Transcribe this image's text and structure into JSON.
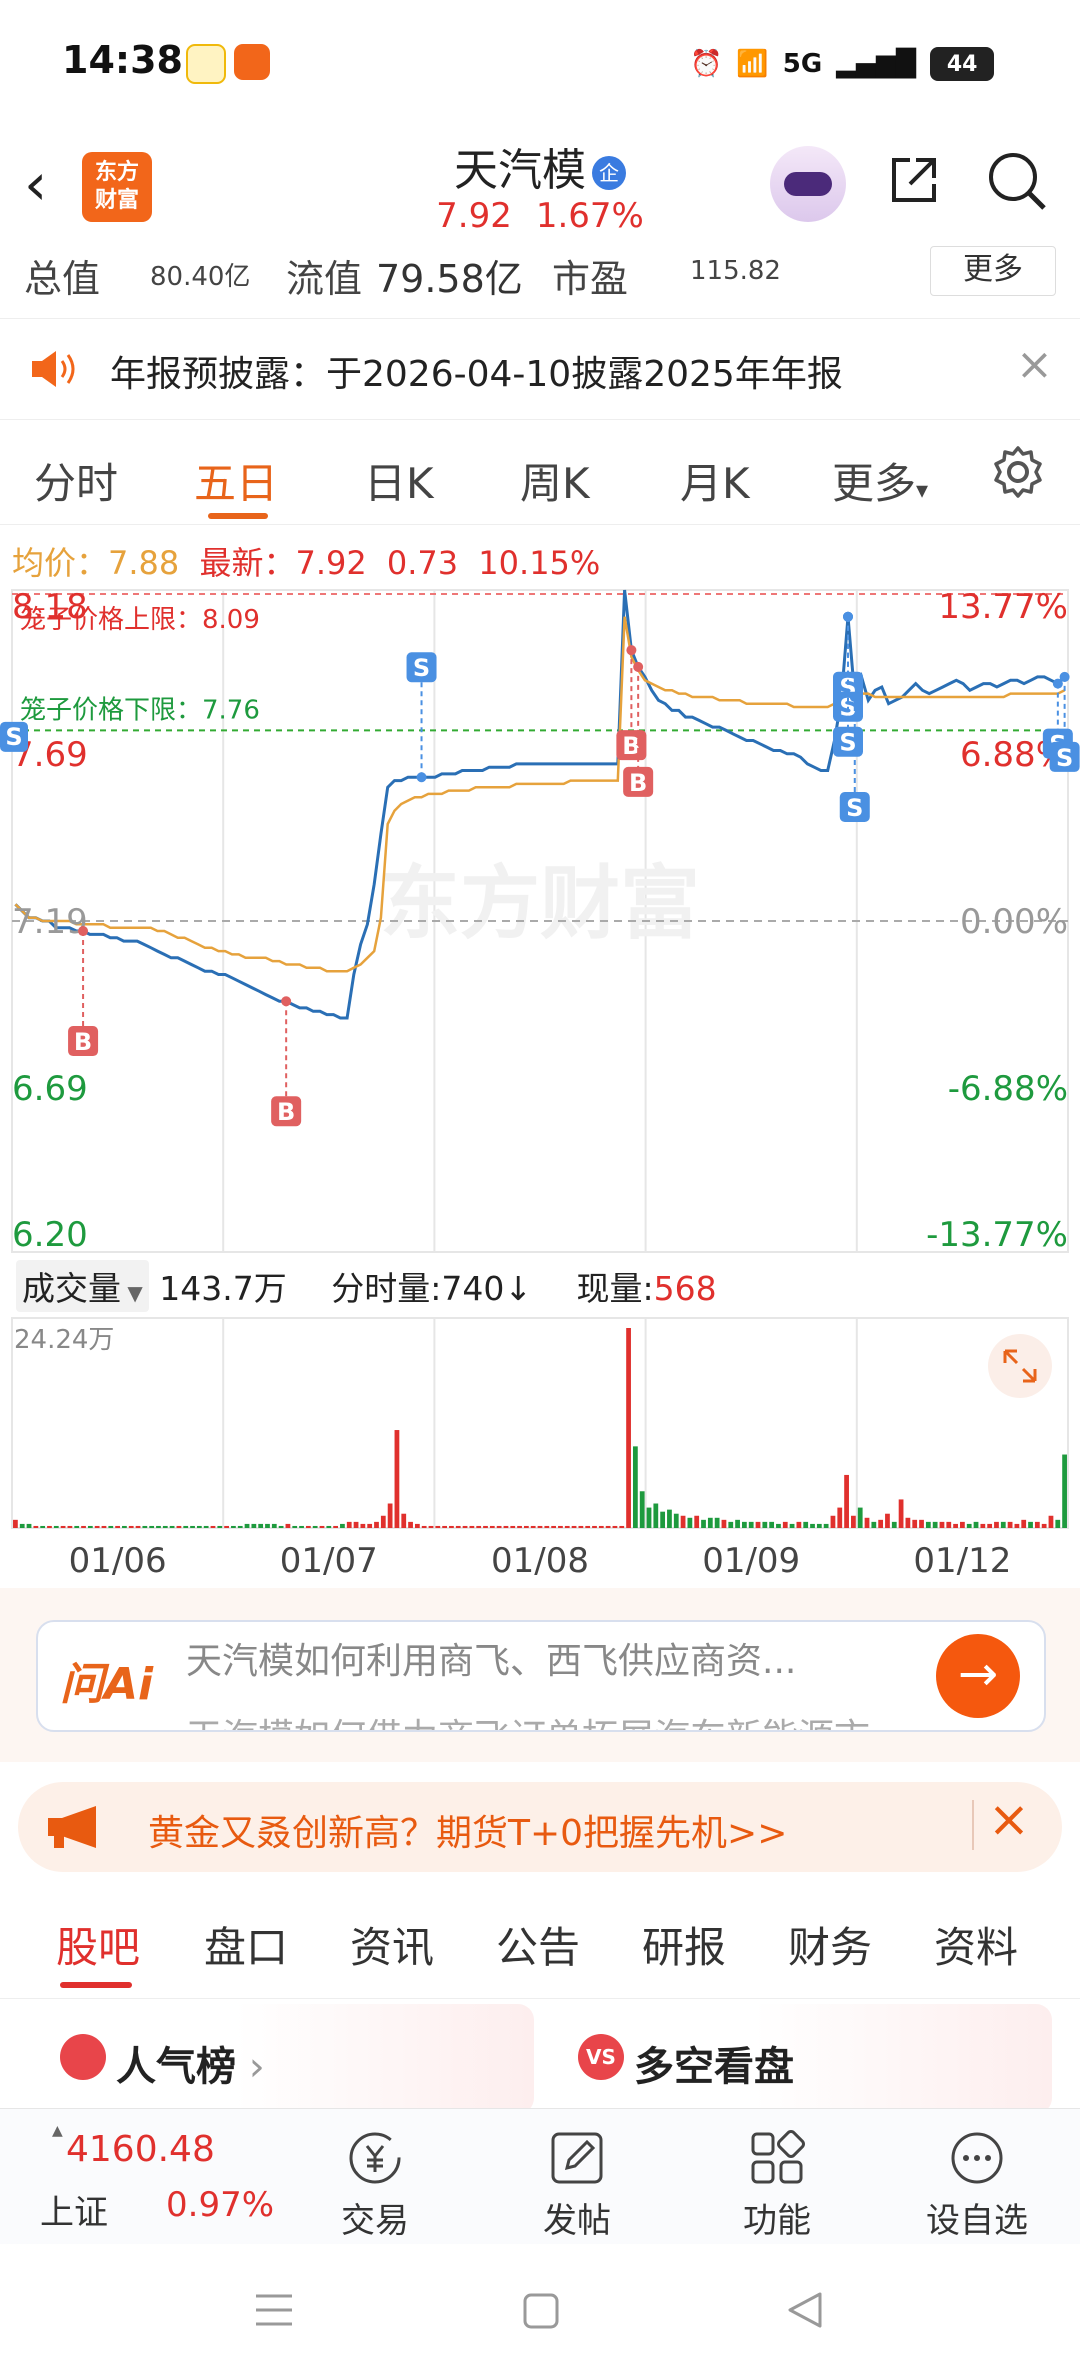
{
  "status_bar": {
    "time": "14:38",
    "network": "5G",
    "battery": "44"
  },
  "header": {
    "logo_line1": "东方",
    "logo_line2": "财富",
    "stock_name": "天汽模",
    "stock_badge": "企",
    "price": "7.92",
    "change_pct": "1.67%"
  },
  "stats": {
    "total_label": "总值",
    "total_value": "80.40亿",
    "float_label": "流值",
    "float_value": "79.58亿",
    "pe_label": "市盈",
    "pe_value": "115.82",
    "more_label": "更多"
  },
  "notice": {
    "text": "年报预披露：于2026-04-10披露2025年年报"
  },
  "chart_tabs": [
    {
      "label": "分时",
      "active": false
    },
    {
      "label": "五日",
      "active": true
    },
    {
      "label": "日K",
      "active": false
    },
    {
      "label": "周K",
      "active": false
    },
    {
      "label": "月K",
      "active": false
    },
    {
      "label": "更多",
      "active": false
    }
  ],
  "price_info": {
    "avg_label": "均价：",
    "avg_value": "7.88",
    "latest_label": "最新：",
    "latest_value": "7.92",
    "change": "0.73",
    "change_pct": "10.15%"
  },
  "chart_data": {
    "type": "line",
    "x_labels": [
      "01/06",
      "01/07",
      "01/08",
      "01/09",
      "01/12"
    ],
    "y_left_ticks": [
      "8.18",
      "7.69",
      "7.19",
      "6.69",
      "6.20"
    ],
    "y_right_ticks": [
      "13.77%",
      "6.88%",
      "0.00%",
      "-6.88%",
      "-13.77%"
    ],
    "ylim": [
      6.2,
      8.18
    ],
    "prev_close": 7.19,
    "cage_upper_label": "笼子价格上限：8.09",
    "cage_upper": 8.09,
    "cage_lower_label": "笼子价格下限：7.76",
    "cage_lower": 7.76,
    "series": [
      {
        "values": [
          7.24,
          7.22,
          7.2,
          7.2,
          7.19,
          7.19,
          7.17,
          7.17,
          7.17,
          7.16,
          7.16,
          7.15,
          7.15,
          7.15,
          7.14,
          7.14,
          7.13,
          7.13,
          7.13,
          7.12,
          7.11,
          7.1,
          7.09,
          7.08,
          7.08,
          7.07,
          7.06,
          7.05,
          7.04,
          7.04,
          7.03,
          7.03,
          7.02,
          7.01,
          7.0,
          6.99,
          6.98,
          6.97,
          6.96,
          6.95,
          6.95,
          6.94,
          6.93,
          6.93,
          6.92,
          6.92,
          6.91,
          6.91,
          6.9,
          6.9,
          7.03,
          7.12,
          7.18,
          7.3,
          7.45,
          7.59,
          7.61,
          7.61,
          7.62,
          7.62,
          7.62,
          7.62,
          7.62,
          7.63,
          7.63,
          7.63,
          7.64,
          7.64,
          7.64,
          7.64,
          7.65,
          7.65,
          7.65,
          7.65,
          7.66,
          7.66,
          7.66,
          7.66,
          7.66,
          7.66,
          7.66,
          7.66,
          7.66,
          7.66,
          7.66,
          7.66,
          7.66,
          7.66,
          7.66,
          7.66,
          8.18,
          8.0,
          7.95,
          7.92,
          7.88,
          7.85,
          7.84,
          7.82,
          7.82,
          7.8,
          7.8,
          7.79,
          7.78,
          7.77,
          7.77,
          7.76,
          7.75,
          7.74,
          7.73,
          7.73,
          7.72,
          7.71,
          7.7,
          7.7,
          7.69,
          7.69,
          7.68,
          7.66,
          7.65,
          7.64,
          7.64,
          7.73,
          7.85,
          8.1,
          7.86,
          7.92,
          7.85,
          7.88,
          7.89,
          7.84,
          7.85,
          7.86,
          7.88,
          7.9,
          7.88,
          7.87,
          7.88,
          7.89,
          7.9,
          7.91,
          7.9,
          7.88,
          7.89,
          7.9,
          7.9,
          7.89,
          7.9,
          7.91,
          7.91,
          7.9,
          7.91,
          7.92,
          7.92,
          7.91,
          7.9,
          7.92
        ]
      },
      {
        "values": [
          7.24,
          7.22,
          7.2,
          7.2,
          7.19,
          7.19,
          7.19,
          7.19,
          7.19,
          7.18,
          7.18,
          7.18,
          7.18,
          7.18,
          7.17,
          7.17,
          7.17,
          7.17,
          7.17,
          7.17,
          7.17,
          7.16,
          7.16,
          7.15,
          7.14,
          7.14,
          7.13,
          7.12,
          7.11,
          7.11,
          7.1,
          7.1,
          7.09,
          7.09,
          7.08,
          7.08,
          7.08,
          7.08,
          7.07,
          7.07,
          7.06,
          7.06,
          7.06,
          7.05,
          7.05,
          7.05,
          7.04,
          7.04,
          7.04,
          7.04,
          7.05,
          7.06,
          7.08,
          7.1,
          7.2,
          7.48,
          7.52,
          7.54,
          7.55,
          7.56,
          7.56,
          7.57,
          7.57,
          7.57,
          7.58,
          7.58,
          7.58,
          7.58,
          7.59,
          7.59,
          7.59,
          7.59,
          7.59,
          7.59,
          7.6,
          7.6,
          7.6,
          7.6,
          7.6,
          7.6,
          7.6,
          7.6,
          7.61,
          7.61,
          7.61,
          7.61,
          7.61,
          7.61,
          7.61,
          7.61,
          8.1,
          7.98,
          7.94,
          7.91,
          7.9,
          7.89,
          7.88,
          7.88,
          7.87,
          7.87,
          7.86,
          7.86,
          7.86,
          7.86,
          7.85,
          7.85,
          7.85,
          7.85,
          7.84,
          7.84,
          7.84,
          7.84,
          7.84,
          7.84,
          7.84,
          7.83,
          7.83,
          7.83,
          7.83,
          7.83,
          7.83,
          7.84,
          7.85,
          7.86,
          7.87,
          7.87,
          7.87,
          7.86,
          7.86,
          7.86,
          7.86,
          7.86,
          7.86,
          7.86,
          7.86,
          7.86,
          7.86,
          7.86,
          7.86,
          7.86,
          7.86,
          7.86,
          7.86,
          7.86,
          7.86,
          7.86,
          7.86,
          7.87,
          7.87,
          7.87,
          7.87,
          7.87,
          7.87,
          7.87,
          7.87,
          7.88
        ]
      }
    ],
    "trade_marks": [
      {
        "label": "B",
        "day": 0,
        "frac": 0.3
      },
      {
        "label": "B",
        "day": 1,
        "frac": 0.22
      },
      {
        "label": "S",
        "day": 2,
        "frac": 0.01
      },
      {
        "label": "B",
        "day": 3,
        "frac": 0.05
      },
      {
        "label": "B",
        "day": 3,
        "frac": 0.05
      },
      {
        "label": "S",
        "day": 3,
        "frac": 0.8
      },
      {
        "label": "S",
        "day": 3,
        "frac": 0.8
      },
      {
        "label": "S",
        "day": 3,
        "frac": 0.8
      },
      {
        "label": "S",
        "day": 3,
        "frac": 0.8
      },
      {
        "label": "S",
        "day": 4,
        "frac": 0.92
      },
      {
        "label": "S",
        "day": 4,
        "frac": 0.92
      },
      {
        "label": "S",
        "day": 0,
        "frac": 0.0
      }
    ],
    "watermark": "东方财富",
    "volume": {
      "max_label": "24.24万",
      "values": [
        4,
        2,
        2,
        1,
        1,
        1,
        1,
        1,
        1,
        1,
        1,
        1,
        1,
        1,
        1,
        1,
        1,
        1,
        1,
        1,
        1,
        1,
        1,
        1,
        1,
        1,
        1,
        1,
        1,
        1,
        1,
        1,
        1,
        1,
        2,
        2,
        2,
        2,
        2,
        1,
        2,
        1,
        1,
        1,
        1,
        1,
        1,
        1,
        2,
        3,
        3,
        2,
        2,
        3,
        6,
        12,
        48,
        7,
        3,
        2,
        1,
        1,
        1,
        1,
        1,
        1,
        1,
        1,
        1,
        1,
        1,
        1,
        1,
        1,
        1,
        1,
        1,
        1,
        1,
        1,
        1,
        1,
        1,
        1,
        1,
        1,
        1,
        1,
        1,
        1,
        98,
        40,
        18,
        10,
        12,
        8,
        9,
        7,
        6,
        5,
        6,
        4,
        5,
        5,
        4,
        3,
        4,
        3,
        3,
        3,
        3,
        3,
        2,
        3,
        2,
        3,
        3,
        2,
        2,
        2,
        6,
        10,
        26,
        6,
        10,
        5,
        3,
        4,
        7,
        3,
        14,
        5,
        4,
        4,
        3,
        3,
        3,
        3,
        2,
        3,
        2,
        3,
        2,
        2,
        3,
        3,
        3,
        2,
        4,
        3,
        3,
        2,
        6,
        4,
        36
      ]
    }
  },
  "volume_header": {
    "select_label": "成交量",
    "total": "143.7万",
    "timeshare_label": "分时量:",
    "timeshare_value": "740",
    "timeshare_arrow": "↓",
    "current_label": "现量:",
    "current_value": "568"
  },
  "ai_search": {
    "logo": "问Ai",
    "question": "天汽模如何利用商飞、西飞供应商资...",
    "question2": "天汽模如何借力商飞订单拓展汽车新能源市..."
  },
  "promo": {
    "text": "黄金又叒创新高？期货T+0把握先机>>"
  },
  "bottom_tabs": [
    {
      "label": "股吧",
      "active": true
    },
    {
      "label": "盘口",
      "active": false
    },
    {
      "label": "资讯",
      "active": false
    },
    {
      "label": "公告",
      "active": false
    },
    {
      "label": "研报",
      "active": false
    },
    {
      "label": "财务",
      "active": false
    },
    {
      "label": "资料",
      "active": false
    }
  ],
  "cards": {
    "popularity": "人气榜",
    "bull_bear": "多空看盘"
  },
  "bottom_nav": {
    "index_value": "4160.48",
    "index_name": "上证",
    "index_change": "0.97%",
    "trade": "交易",
    "post": "发帖",
    "functions": "功能",
    "watchlist": "设自选"
  },
  "colors": {
    "accent": "#e8641a",
    "up": "#e0302d",
    "down": "#1e9a3e",
    "line": "#2a6fb5",
    "avg": "#e6a23c"
  }
}
